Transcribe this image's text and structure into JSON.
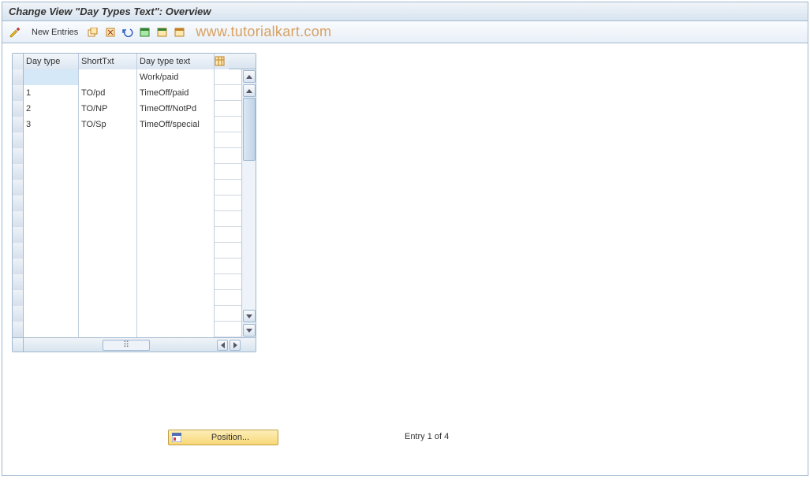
{
  "title": "Change View \"Day Types Text\": Overview",
  "toolbar": {
    "new_entries": "New Entries"
  },
  "watermark": "www.tutorialkart.com",
  "grid": {
    "headers": {
      "daytype": "Day type",
      "shorttxt": "ShortTxt",
      "daytyptxt": "Day type text"
    },
    "rows": [
      {
        "daytype": "",
        "shorttxt": "",
        "daytyptxt": "Work/paid",
        "highlight": true
      },
      {
        "daytype": "1",
        "shorttxt": "TO/pd",
        "daytyptxt": "TimeOff/paid"
      },
      {
        "daytype": "2",
        "shorttxt": "TO/NP",
        "daytyptxt": "TimeOff/NotPd"
      },
      {
        "daytype": "3",
        "shorttxt": "TO/Sp",
        "daytyptxt": "TimeOff/special"
      },
      {
        "daytype": "",
        "shorttxt": "",
        "daytyptxt": ""
      },
      {
        "daytype": "",
        "shorttxt": "",
        "daytyptxt": ""
      },
      {
        "daytype": "",
        "shorttxt": "",
        "daytyptxt": ""
      },
      {
        "daytype": "",
        "shorttxt": "",
        "daytyptxt": ""
      },
      {
        "daytype": "",
        "shorttxt": "",
        "daytyptxt": ""
      },
      {
        "daytype": "",
        "shorttxt": "",
        "daytyptxt": ""
      },
      {
        "daytype": "",
        "shorttxt": "",
        "daytyptxt": ""
      },
      {
        "daytype": "",
        "shorttxt": "",
        "daytyptxt": ""
      },
      {
        "daytype": "",
        "shorttxt": "",
        "daytyptxt": ""
      },
      {
        "daytype": "",
        "shorttxt": "",
        "daytyptxt": ""
      },
      {
        "daytype": "",
        "shorttxt": "",
        "daytyptxt": ""
      },
      {
        "daytype": "",
        "shorttxt": "",
        "daytyptxt": ""
      },
      {
        "daytype": "",
        "shorttxt": "",
        "daytyptxt": ""
      }
    ]
  },
  "position_button": "Position...",
  "entry_status": "Entry 1 of 4"
}
